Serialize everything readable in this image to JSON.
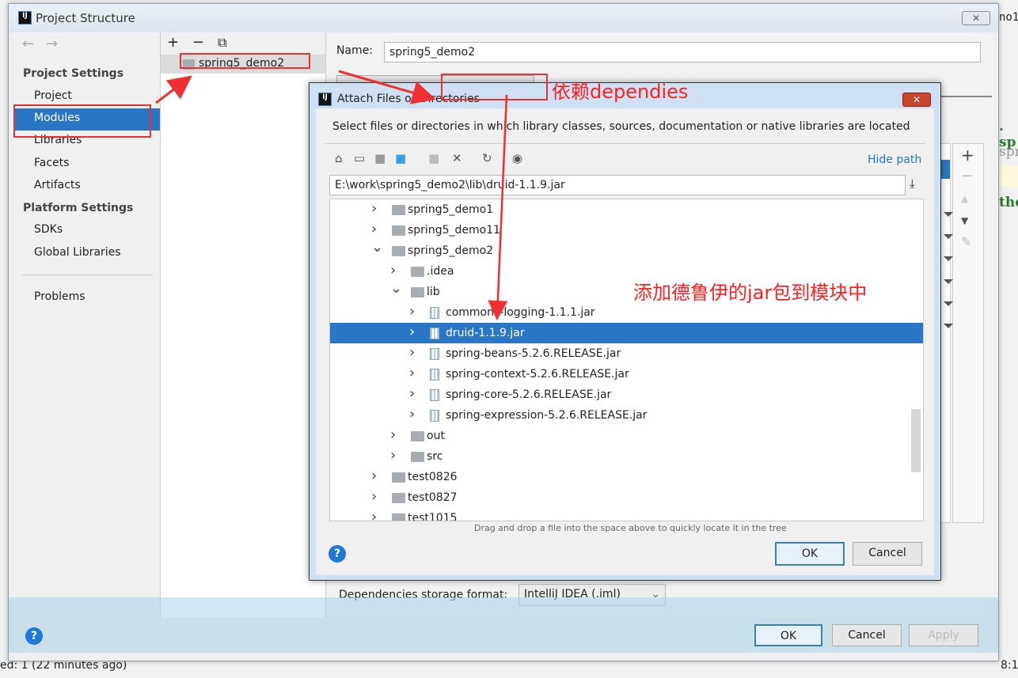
{
  "background": {
    "status_text": "ed: 1 (22 minutes ago)",
    "line_col": "8:1",
    "tab_fragment": "no1",
    "code_frag1": ". sp",
    "code_frag2": "spr",
    "code_frag3": "the"
  },
  "window": {
    "title": "Project Structure",
    "close": "✕"
  },
  "sidebar": {
    "back": "←",
    "forward": "→",
    "project_settings": "Project Settings",
    "items": [
      {
        "label": "Project"
      },
      {
        "label": "Modules"
      },
      {
        "label": "Libraries"
      },
      {
        "label": "Facets"
      },
      {
        "label": "Artifacts"
      }
    ],
    "platform_settings": "Platform Settings",
    "platform_items": [
      {
        "label": "SDKs"
      },
      {
        "label": "Global Libraries"
      }
    ],
    "problems": "Problems"
  },
  "modules": {
    "add": "+",
    "remove": "−",
    "copy": "⧉",
    "items": [
      {
        "label": "spring5_demo2"
      }
    ]
  },
  "module_detail": {
    "name_label": "Name:",
    "name_value": "spring5_demo2",
    "storage_label": "Dependencies storage format:",
    "storage_value": "IntelliJ IDEA (.iml)",
    "side_toolbar": {
      "add": "+",
      "remove": "−",
      "up": "▲",
      "down": "▼",
      "edit": "✎"
    }
  },
  "footer": {
    "ok": "OK",
    "cancel": "Cancel",
    "apply": "Apply",
    "help": "?"
  },
  "dialog": {
    "title": "Attach Files or Directories",
    "close": "✕",
    "description": "Select files or directories in which library classes, sources, documentation or native libraries are located",
    "hide_path": "Hide path",
    "path_value": "E:\\work\\spring5_demo2\\lib\\druid-1.1.9.jar",
    "toolbar": [
      "home-icon",
      "desktop-icon",
      "project-icon",
      "module-icon",
      "new-folder-icon",
      "delete-icon",
      "refresh-icon",
      "show-hidden-icon"
    ],
    "tree": [
      {
        "label": "spring5_demo1",
        "level": 0,
        "type": "folder",
        "expanded": false
      },
      {
        "label": "spring5_demo11",
        "level": 0,
        "type": "folder",
        "expanded": false
      },
      {
        "label": "spring5_demo2",
        "level": 0,
        "type": "folder",
        "expanded": true
      },
      {
        "label": ".idea",
        "level": 1,
        "type": "folder",
        "expanded": false
      },
      {
        "label": "lib",
        "level": 1,
        "type": "folder",
        "expanded": true
      },
      {
        "label": "commons-logging-1.1.1.jar",
        "level": 2,
        "type": "jar",
        "expanded": false
      },
      {
        "label": "druid-1.1.9.jar",
        "level": 2,
        "type": "jar",
        "expanded": false,
        "selected": true
      },
      {
        "label": "spring-beans-5.2.6.RELEASE.jar",
        "level": 2,
        "type": "jar",
        "expanded": false
      },
      {
        "label": "spring-context-5.2.6.RELEASE.jar",
        "level": 2,
        "type": "jar",
        "expanded": false
      },
      {
        "label": "spring-core-5.2.6.RELEASE.jar",
        "level": 2,
        "type": "jar",
        "expanded": false
      },
      {
        "label": "spring-expression-5.2.6.RELEASE.jar",
        "level": 2,
        "type": "jar",
        "expanded": false
      },
      {
        "label": "out",
        "level": 1,
        "type": "folder",
        "expanded": false
      },
      {
        "label": "src",
        "level": 1,
        "type": "folder",
        "expanded": false
      },
      {
        "label": "test0826",
        "level": 0,
        "type": "folder",
        "expanded": false
      },
      {
        "label": "test0827",
        "level": 0,
        "type": "folder",
        "expanded": false
      },
      {
        "label": "test1015",
        "level": 0,
        "type": "folder",
        "expanded": false
      }
    ],
    "hint": "Drag and drop a file into the space above to quickly locate it in the tree",
    "ok": "OK",
    "cancel": "Cancel",
    "help": "?"
  },
  "annotations": {
    "dependencies_note": "依赖dependies",
    "add_jar_note": "添加德鲁伊的jar包到模块中",
    "color": "#ff2020"
  }
}
